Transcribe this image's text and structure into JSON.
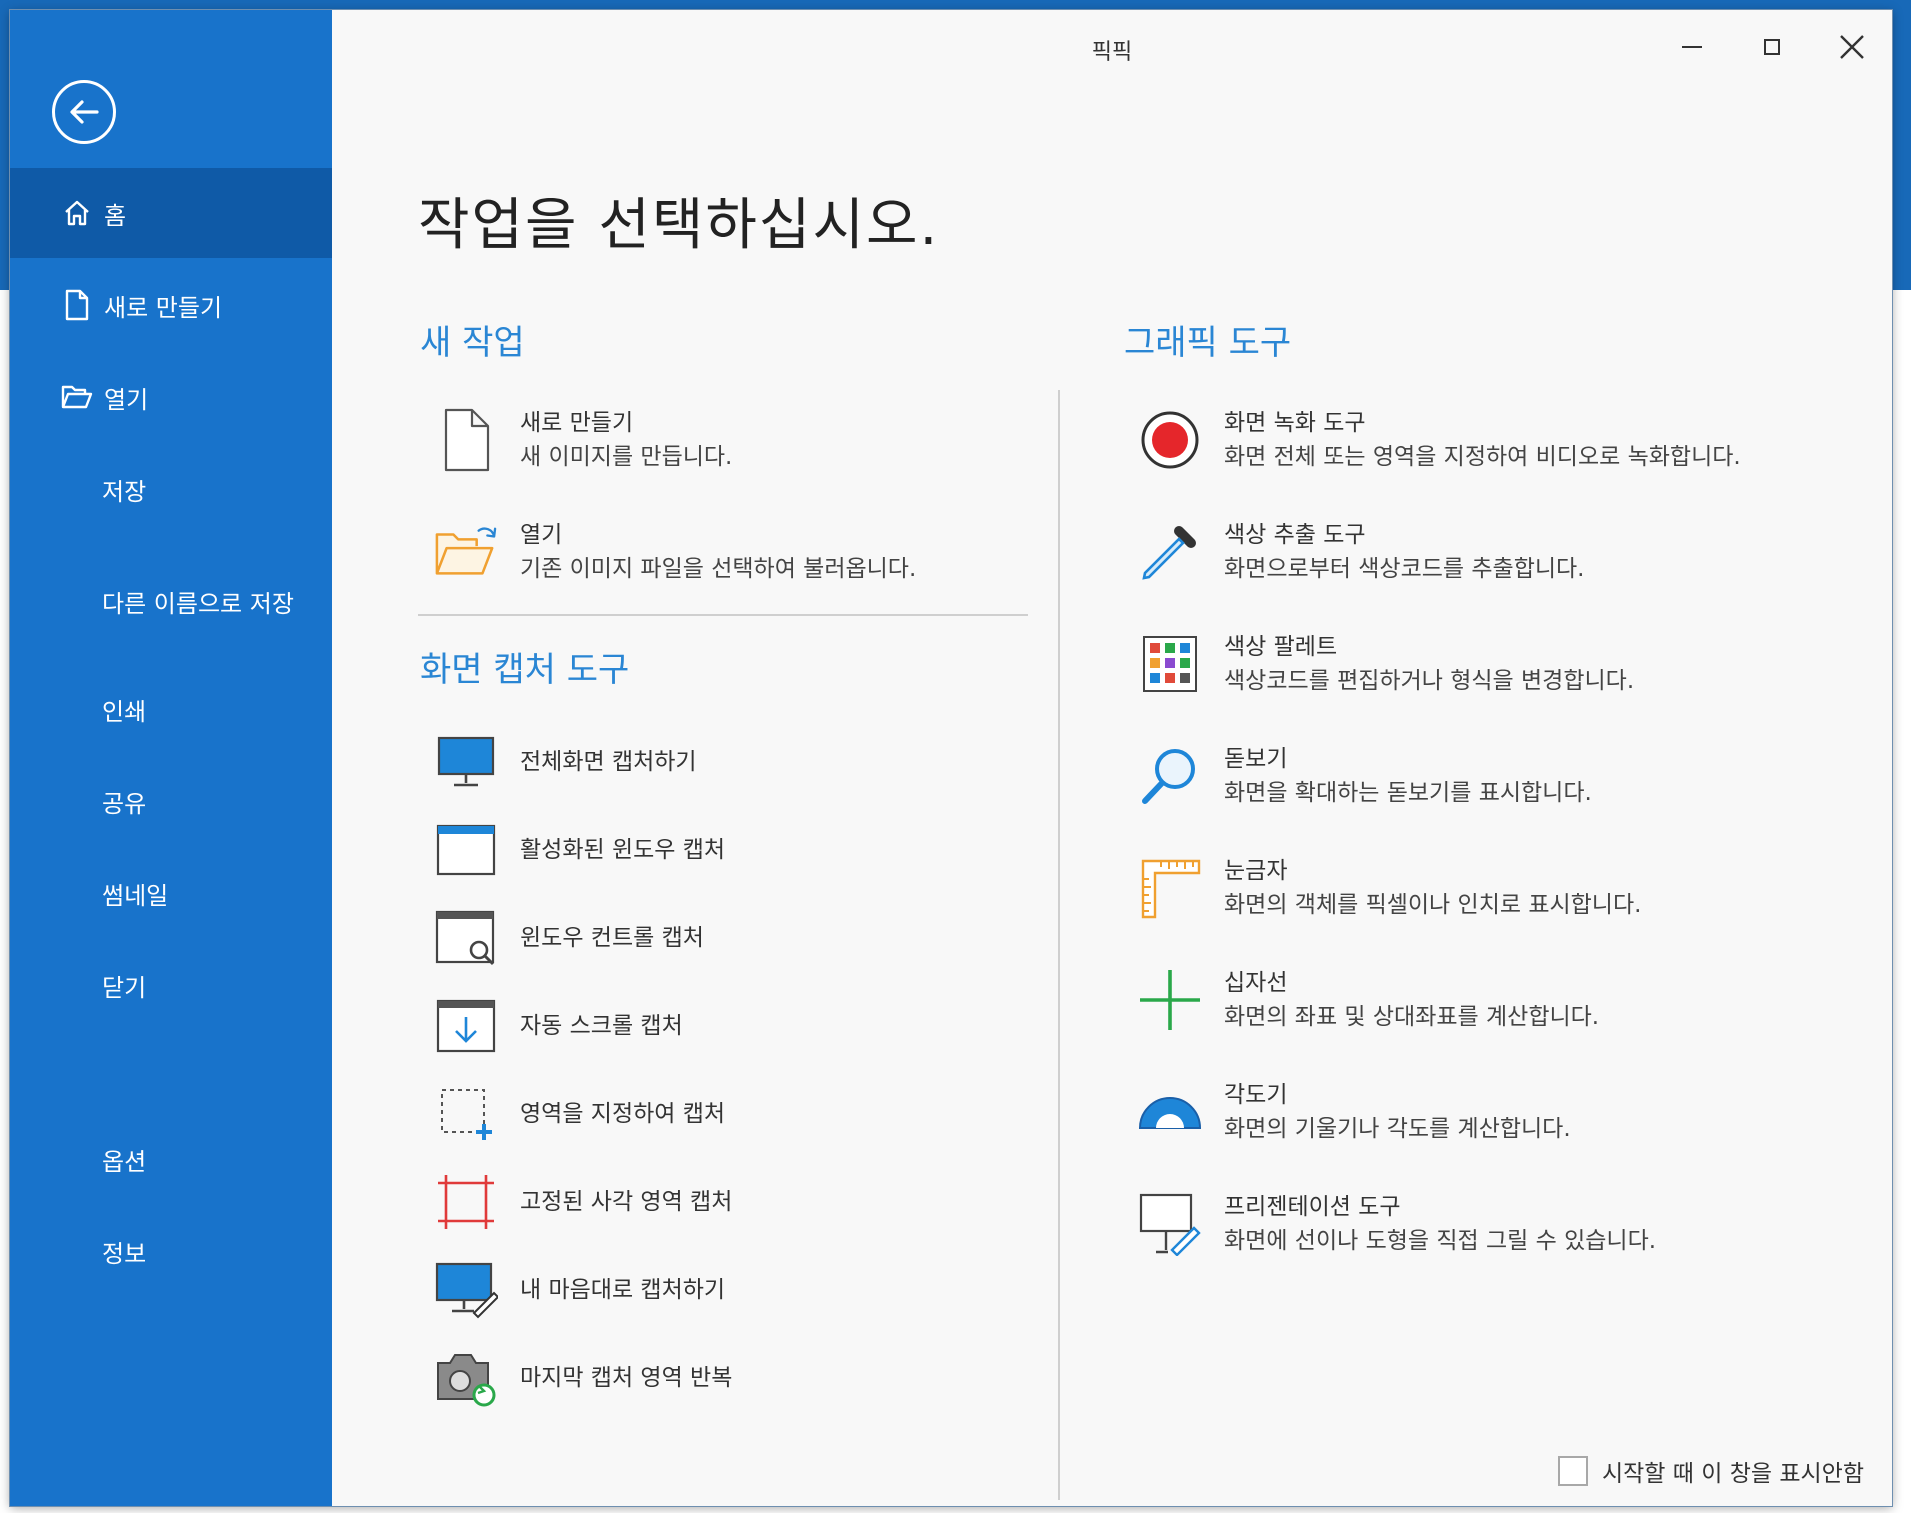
{
  "window": {
    "title": "픽픽",
    "minimize_icon": "minimize-icon",
    "maximize_icon": "maximize-icon",
    "close_icon": "close-icon"
  },
  "colors": {
    "sidebar": "#1873cb",
    "sidebar_active": "#0f5aa7",
    "accent": "#2a86d4",
    "background": "#f8f8f8"
  },
  "sidebar": {
    "back_icon": "back-arrow-icon",
    "items": [
      {
        "label": "홈",
        "icon": "home-icon"
      },
      {
        "label": "새로 만들기",
        "icon": "new-file-icon"
      },
      {
        "label": "열기",
        "icon": "open-folder-icon"
      },
      {
        "label": "저장"
      },
      {
        "label": "다른 이름으로 저장"
      },
      {
        "label": "인쇄"
      },
      {
        "label": "공유"
      },
      {
        "label": "썸네일"
      },
      {
        "label": "닫기"
      },
      {
        "label": "옵션"
      },
      {
        "label": "정보"
      }
    ]
  },
  "main": {
    "heading": "작업을 선택하십시오.",
    "new_task": {
      "title": "새 작업",
      "items": [
        {
          "label": "새로 만들기",
          "desc": "새 이미지를 만듭니다.",
          "icon": "blank-document-icon"
        },
        {
          "label": "열기",
          "desc": "기존 이미지 파일을 선택하여 불러옵니다.",
          "icon": "open-folder-icon"
        }
      ]
    },
    "capture": {
      "title": "화면 캡처 도구",
      "items": [
        {
          "label": "전체화면 캡처하기",
          "icon": "monitor-icon"
        },
        {
          "label": "활성화된 윈도우 캡처",
          "icon": "window-icon"
        },
        {
          "label": "윈도우 컨트롤 캡처",
          "icon": "window-search-icon"
        },
        {
          "label": "자동 스크롤 캡처",
          "icon": "scroll-down-icon"
        },
        {
          "label": "영역을 지정하여 캡처",
          "icon": "region-select-icon"
        },
        {
          "label": "고정된 사각 영역 캡처",
          "icon": "fixed-rect-icon"
        },
        {
          "label": "내 마음대로 캡처하기",
          "icon": "monitor-pen-icon"
        },
        {
          "label": "마지막 캡처 영역 반복",
          "icon": "camera-repeat-icon"
        }
      ]
    },
    "graphics": {
      "title": "그래픽 도구",
      "items": [
        {
          "label": "화면 녹화 도구",
          "desc": "화면 전체 또는 영역을 지정하여 비디오로 녹화합니다.",
          "icon": "record-icon"
        },
        {
          "label": "색상 추출 도구",
          "desc": "화면으로부터 색상코드를 추출합니다.",
          "icon": "eyedropper-icon"
        },
        {
          "label": "색상 팔레트",
          "desc": "색상코드를 편집하거나 형식을 변경합니다.",
          "icon": "palette-grid-icon"
        },
        {
          "label": "돋보기",
          "desc": "화면을 확대하는 돋보기를 표시합니다.",
          "icon": "magnifier-icon"
        },
        {
          "label": "눈금자",
          "desc": "화면의 객체를 픽셀이나 인치로 표시합니다.",
          "icon": "ruler-icon"
        },
        {
          "label": "십자선",
          "desc": "화면의 좌표 및 상대좌표를 계산합니다.",
          "icon": "crosshair-icon"
        },
        {
          "label": "각도기",
          "desc": "화면의 기울기나 각도를 계산합니다.",
          "icon": "protractor-icon"
        },
        {
          "label": "프리젠테이션 도구",
          "desc": "화면에 선이나 도형을 직접 그릴 수 있습니다.",
          "icon": "whiteboard-pen-icon"
        }
      ]
    },
    "startup_checkbox": {
      "label": "시작할 때 이 창을 표시안함",
      "checked": false
    }
  }
}
